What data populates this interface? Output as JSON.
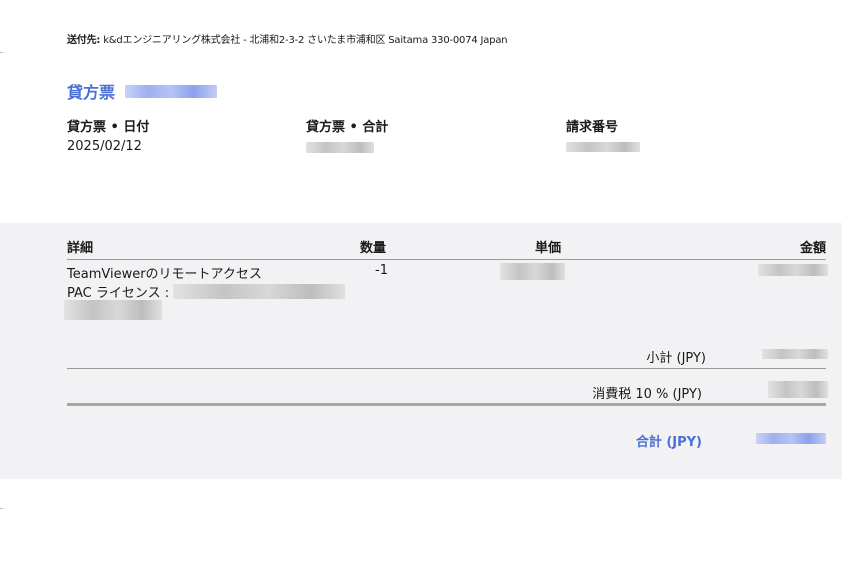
{
  "ship_to": {
    "label": "送付先:",
    "text": "k&dエンジニアリング株式会社 - 北浦和2-3-2 さいたま市浦和区  Saitama  330-0074  Japan"
  },
  "document": {
    "title": "貸方票"
  },
  "meta": {
    "date_label": "貸方票 • 日付",
    "date_value": "2025/02/12",
    "total_label": "貸方票 • 合計",
    "invoice_no_label": "請求番号"
  },
  "table": {
    "headers": {
      "details": "詳細",
      "quantity": "数量",
      "unit_price": "単価",
      "amount": "金額"
    },
    "rows": [
      {
        "description": "TeamViewerのリモートアクセス",
        "license_label": "PAC ライセンス :",
        "quantity": "-1"
      }
    ]
  },
  "totals": {
    "subtotal_label": "小計 (JPY)",
    "tax_label": "消費税 10 % (JPY)",
    "grand_total_label": "合計 (JPY)"
  },
  "colors": {
    "accent": "#4a6fd8",
    "band": "#f2f2f4",
    "rule": "#9a9a9a"
  }
}
